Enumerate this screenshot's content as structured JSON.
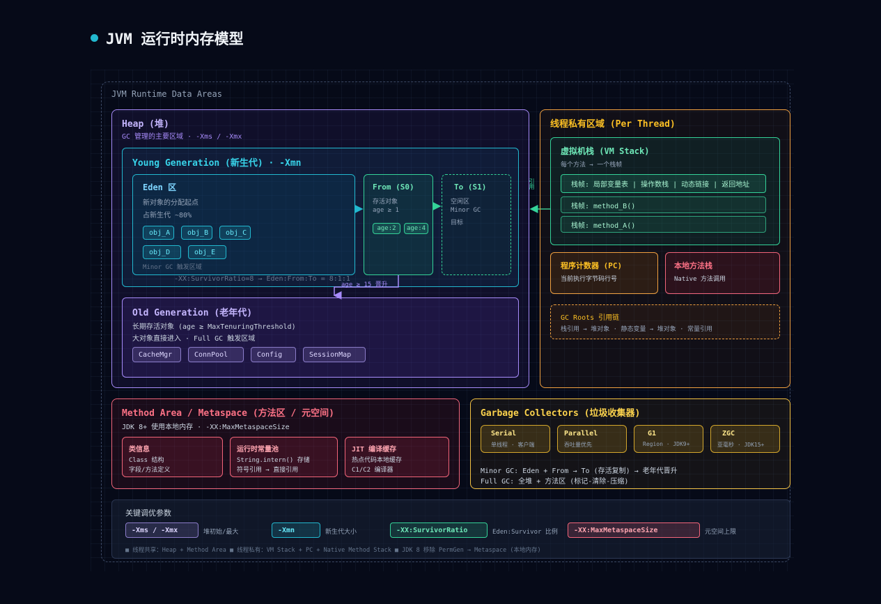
{
  "title": "JVM 运行时内存模型",
  "runtime": {
    "label": "JVM Runtime Data Areas"
  },
  "heap": {
    "title": "Heap (堆)",
    "subtitle": "GC 管理的主要区域 · -Xms / -Xmx",
    "young": {
      "title": "Young Generation (新生代) · -Xmn",
      "eden": {
        "title": "Eden 区",
        "line1": "新对象的分配起点",
        "line2": "占新生代 ~80%",
        "objects": [
          "obj_A",
          "obj_B",
          "obj_C",
          "obj_D",
          "obj_E"
        ],
        "note": "Minor GC 触发区域"
      },
      "from": {
        "title": "From (S0)",
        "line1": "存活对象",
        "line2": "age ≥ 1",
        "tags": [
          "age:2",
          "age:4"
        ]
      },
      "to": {
        "title": "To (S1)",
        "line1": "空闲区",
        "line2": "Minor GC",
        "line3": "目标"
      },
      "ratio": "-XX:SurvivorRatio=8 → Eden:From:To = 8:1:1",
      "promote": "age ≥ 15 晋升"
    },
    "old": {
      "title": "Old Generation (老年代)",
      "line1": "长期存活对象 (age ≥ MaxTenuringThreshold)",
      "line2": "大对象直接进入 · Full GC 触发区域",
      "objects": [
        "CacheMgr",
        "ConnPool",
        "Config",
        "SessionMap"
      ]
    }
  },
  "thread": {
    "title": "线程私有区域 (Per Thread)",
    "ref_label": "引用",
    "stack": {
      "title": "虚拟机栈 (VM Stack)",
      "subtitle": "每个方法 → 一个栈帧",
      "frames": [
        "栈帧: 局部变量表 | 操作数栈 | 动态链接 | 返回地址",
        "栈帧: method_B()",
        "栈帧: method_A()"
      ]
    },
    "pc": {
      "title": "程序计数器 (PC)",
      "subtitle": "当前执行字节码行号"
    },
    "native": {
      "title": "本地方法栈",
      "subtitle": "Native 方法调用"
    },
    "gcroots": {
      "title": "GC Roots 引用链",
      "subtitle": "栈引用 → 堆对象 · 静态变量 → 堆对象 · 常量引用"
    }
  },
  "method": {
    "title": "Method Area / Metaspace (方法区 / 元空间)",
    "subtitle": "JDK 8+ 使用本地内存 · -XX:MaxMetaspaceSize",
    "cards": [
      {
        "title": "类信息",
        "line1": "Class 结构",
        "line2": "字段/方法定义"
      },
      {
        "title": "运行时常量池",
        "line1": "String.intern() 存储",
        "line2": "符号引用 → 直接引用"
      },
      {
        "title": "JIT 编译缓存",
        "line1": "热点代码本地缓存",
        "line2": "C1/C2 编译器"
      }
    ]
  },
  "gc": {
    "title": "Garbage Collectors (垃圾收集器)",
    "collectors": [
      {
        "name": "Serial",
        "desc": "单线程 · 客户端"
      },
      {
        "name": "Parallel",
        "desc": "吞吐量优先"
      },
      {
        "name": "G1",
        "desc": "Region · JDK9+"
      },
      {
        "name": "ZGC",
        "desc": "亚毫秒 · JDK15+"
      }
    ],
    "minor": "Minor GC: Eden + From → To (存活复制) → 老年代晋升",
    "full": "Full GC: 全堆 + 方法区 (标记-清除-压缩)"
  },
  "params": {
    "title": "关键调优参数",
    "items": [
      {
        "flag": "-Xms / -Xmx",
        "desc": "堆初始/最大"
      },
      {
        "flag": "-Xmn",
        "desc": "新生代大小"
      },
      {
        "flag": "-XX:SurvivorRatio",
        "desc": "Eden:Survivor 比例"
      },
      {
        "flag": "-XX:MaxMetaspaceSize",
        "desc": "元空间上限"
      }
    ],
    "footer": "■ 线程共享：Heap + Method Area ■ 线程私有：VM Stack + PC + Native Method Stack ■ JDK 8 移除 PermGen → Metaspace (本地内存)"
  }
}
